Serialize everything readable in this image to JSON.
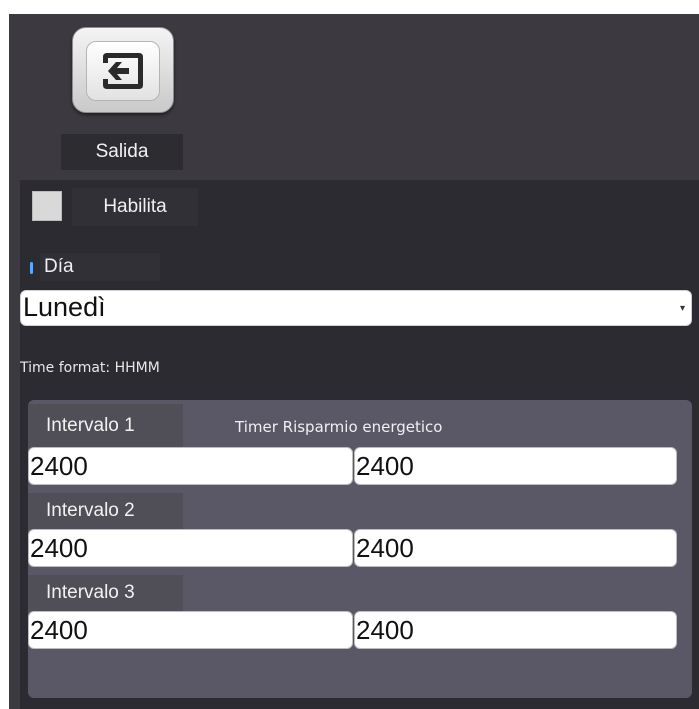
{
  "toolbar": {
    "exit_label": "Salida",
    "exit_icon": "exit-arrow-icon"
  },
  "form": {
    "enable_label": "Habilita",
    "enable_checked": false,
    "day_label": "Día",
    "day_value": "Lunedì",
    "time_format": "Time format: HHMM"
  },
  "timer": {
    "title": "Timer Risparmio energetico",
    "intervals": [
      {
        "label": "Intervalo 1",
        "start": "2400",
        "end": "2400"
      },
      {
        "label": "Intervalo 2",
        "start": "2400",
        "end": "2400"
      },
      {
        "label": "Intervalo 3",
        "start": "2400",
        "end": "2400"
      }
    ]
  }
}
